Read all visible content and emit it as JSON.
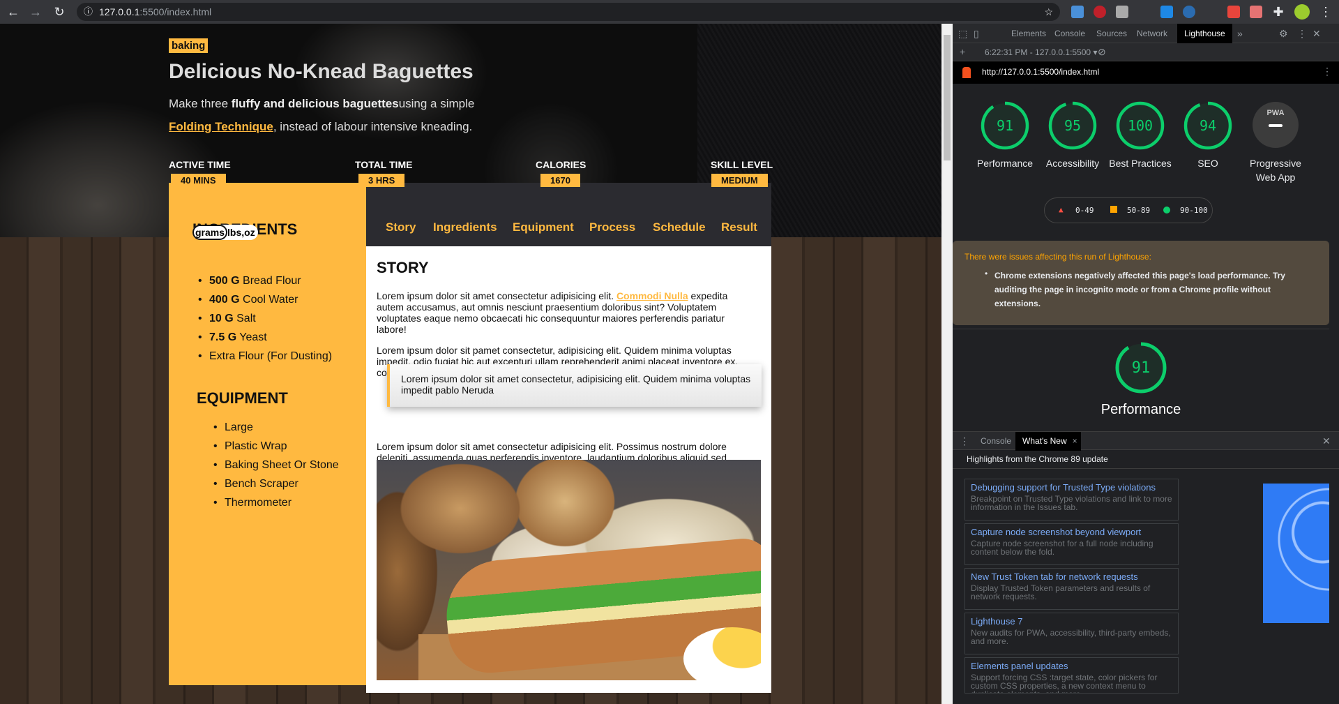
{
  "browser": {
    "url_host": "127.0.0.1",
    "url_path": ":5500/index.html"
  },
  "hero": {
    "tag": "baking",
    "title": "Delicious No-Knead Baguettes",
    "sub_pre": "Make three ",
    "sub_bold": "fluffy and delicious baguettes",
    "sub_post": "using a simple",
    "link": "Folding Technique",
    "sub_end": ", instead of labour intensive kneading.",
    "stats": [
      {
        "label": "ACTIVE TIME",
        "value": "40 MINS"
      },
      {
        "label": "TOTAL TIME",
        "value": "3 HRS"
      },
      {
        "label": "CALORIES",
        "value": "1670"
      },
      {
        "label": "SKILL LEVEL",
        "value": "MEDIUM"
      }
    ]
  },
  "ingredients": {
    "title": "INGREDIENTS",
    "unit_on": "grams",
    "unit_off": "lbs,oz",
    "items": [
      {
        "qty": "500 G",
        "name": " Bread Flour"
      },
      {
        "qty": "400 G",
        "name": " Cool Water"
      },
      {
        "qty": "10 G",
        "name": " Salt"
      },
      {
        "qty": "7.5 G",
        "name": " Yeast"
      },
      {
        "qty": "",
        "name": "Extra Flour (For Dusting)"
      }
    ]
  },
  "equipment": {
    "title": "EQUIPMENT",
    "items": [
      "Large",
      "Plastic Wrap",
      "Baking Sheet Or Stone",
      "Bench Scraper",
      "Thermometer"
    ]
  },
  "nav": [
    "Story",
    "Ingredients",
    "Equipment",
    "Process",
    "Schedule",
    "Result"
  ],
  "story": {
    "title": "STORY",
    "p1_pre": "Lorem ipsum dolor sit amet consectetur adipisicing elit. ",
    "p1_link": "Commodi Nulla",
    "p1_post": " expedita autem accusamus, aut omnis nesciunt praesentium doloribus sint? Voluptatem voluptates eaque nemo obcaecati hic consequuntur maiores perferendis pariatur labore!",
    "p2": "Lorem ipsum dolor sit pamet consectetur, adipisicing elit. Quidem minima voluptas impedit, odio fugiat hic aut excepturi ullam reprehenderit animi placeat inventore ex, consectetur repellat quisquam natus rem vero reiciendis.",
    "quote": "Lorem ipsum dolor sit amet consectetur, adipisicing elit. Quidem minima voluptas impedit pablo Neruda",
    "p3": "Lorem ipsum dolor sit amet consectetur adipisicing elit. Possimus nostrum dolore deleniti, assumenda quas perferendis inventore, laudantium doloribus aliquid sed pariatur minima hic. Ut, quidem maiores nesciunt incidunt blanditiis quas!"
  },
  "devtools": {
    "tabs": [
      "Elements",
      "Console",
      "Sources",
      "Network",
      "Lighthouse"
    ],
    "active_tab": "Lighthouse",
    "run": "6:22:31 PM - 127.0.0.1:5500",
    "report_url": "http://127.0.0.1:5500/index.html",
    "scores": [
      {
        "value": 91,
        "label": "Performance"
      },
      {
        "value": 95,
        "label": "Accessibility"
      },
      {
        "value": 100,
        "label": "Best Practices"
      },
      {
        "value": 94,
        "label": "SEO"
      }
    ],
    "pwa": {
      "badge": "PWA",
      "label": "Progressive Web App"
    },
    "legend": [
      "0-49",
      "50-89",
      "90-100"
    ],
    "colors": {
      "pass": "#0cce6b",
      "average": "#ffa400",
      "fail": "#ff4e42",
      "accent": "#ffb940"
    },
    "warning_title": "There were issues affecting this run of Lighthouse:",
    "warning_item": "Chrome extensions negatively affected this page's load performance. Try auditing the page in incognito mode or from a Chrome profile without extensions.",
    "perf_score": 91,
    "perf_label": "Performance",
    "drawer_tabs": [
      "Console",
      "What's New"
    ],
    "highlights": "Highlights from the Chrome 89 update",
    "cards": [
      {
        "h": "Debugging support for Trusted Type violations",
        "d": "Breakpoint on Trusted Type violations and link to more information in the Issues tab."
      },
      {
        "h": "Capture node screenshot beyond viewport",
        "d": "Capture node screenshot for a full node including content below the fold."
      },
      {
        "h": "New Trust Token tab for network requests",
        "d": "Display Trusted Token parameters and results of network requests."
      },
      {
        "h": "Lighthouse 7",
        "d": "New audits for PWA, accessibility, third-party embeds, and more."
      },
      {
        "h": "Elements panel updates",
        "d": "Support forcing CSS :target state, color pickers for custom CSS properties, a new context menu to duplicate elements, and more."
      }
    ]
  }
}
